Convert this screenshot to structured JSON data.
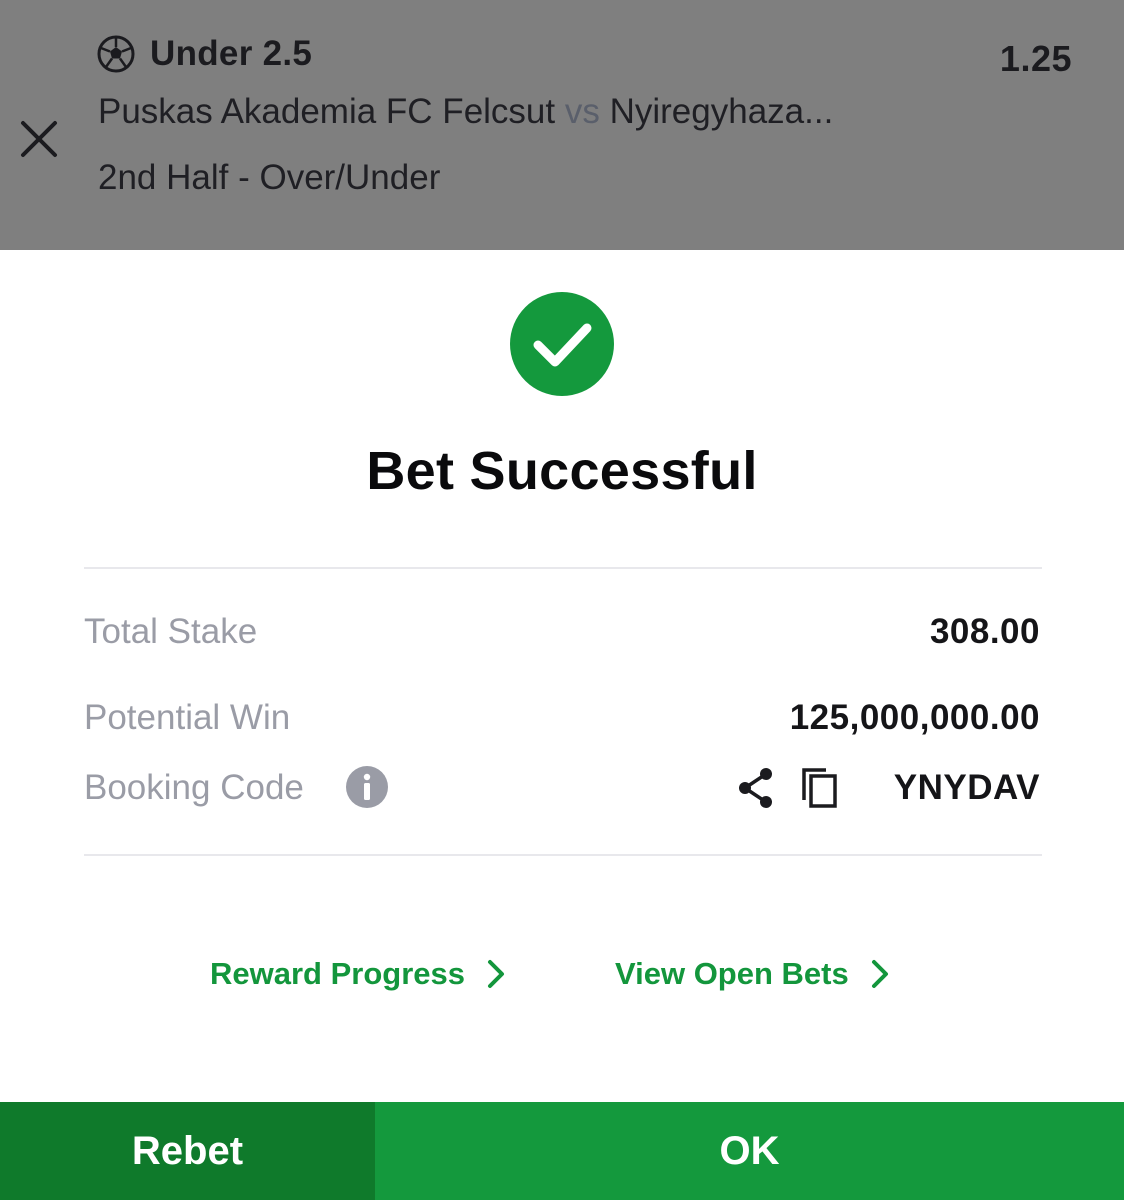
{
  "selection": {
    "title": "Under 2.5",
    "odds": "1.25",
    "home_team": "Puskas Akademia FC Felcsut",
    "vs": "vs",
    "away_team": "Nyiregyhaza...",
    "market": "2nd Half - Over/Under",
    "sport_icon": "soccer-ball-icon"
  },
  "result": {
    "title": "Bet Successful",
    "icon": "check-circle-icon",
    "color": "#14993d"
  },
  "summary": {
    "total_stake_label": "Total Stake",
    "total_stake_value": "308.00",
    "potential_win_label": "Potential Win",
    "potential_win_value": "125,000,000.00",
    "booking_code_label": "Booking Code",
    "booking_code_value": "YNYDAV"
  },
  "links": {
    "reward_progress": "Reward Progress",
    "view_open_bets": "View Open Bets"
  },
  "buttons": {
    "rebet": "Rebet",
    "ok": "OK"
  },
  "colors": {
    "header_bg": "#7f7f7f",
    "accent_green": "#14993d",
    "dark_green": "#0f7a2b",
    "label_gray": "#9a9ca6"
  }
}
